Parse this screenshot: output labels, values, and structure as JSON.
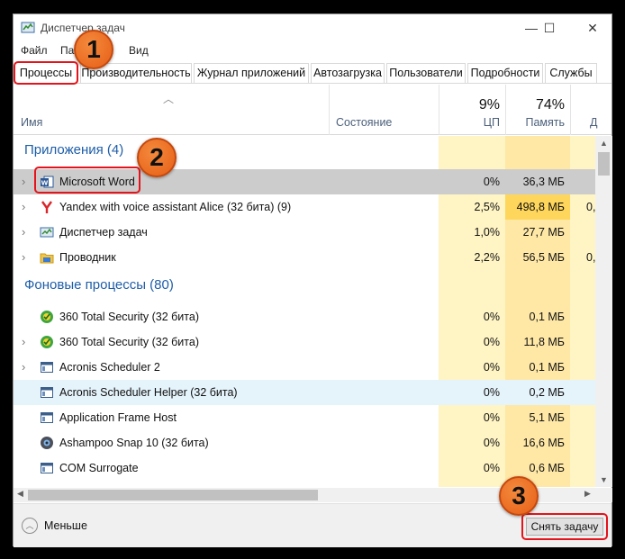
{
  "window": {
    "title": "Диспетчер задач",
    "controls": {
      "minimize": "—",
      "maximize": "☐",
      "close": "✕"
    }
  },
  "menu": {
    "items": [
      "Файл",
      "Па",
      "Вид"
    ]
  },
  "tabs": [
    "Процессы",
    "Производительность",
    "Журнал приложений",
    "Автозагрузка",
    "Пользователи",
    "Подробности",
    "Службы"
  ],
  "active_tab": 0,
  "columns": {
    "name": "Имя",
    "state": "Состояние",
    "cpu": {
      "pct": "9%",
      "label": "ЦП"
    },
    "memory": {
      "pct": "74%",
      "label": "Память"
    },
    "disk": {
      "pct": "",
      "label": "Д"
    }
  },
  "groups": {
    "apps": "Приложения (4)",
    "background": "Фоновые процессы (80)"
  },
  "apps": [
    {
      "name": "Microsoft Word",
      "cpu": "0%",
      "mem": "36,3 МБ",
      "disk": "",
      "icon": "word-icon",
      "expandable": true
    },
    {
      "name": "Yandex with voice assistant Alice (32 бита) (9)",
      "cpu": "2,5%",
      "mem": "498,8 МБ",
      "disk": "0,",
      "icon": "yandex-icon",
      "expandable": true
    },
    {
      "name": "Диспетчер задач",
      "cpu": "1,0%",
      "mem": "27,7 МБ",
      "disk": "",
      "icon": "taskmgr-icon",
      "expandable": true
    },
    {
      "name": "Проводник",
      "cpu": "2,2%",
      "mem": "56,5 МБ",
      "disk": "0,",
      "icon": "explorer-icon",
      "expandable": true
    }
  ],
  "background": [
    {
      "name": "360 Total Security (32 бита)",
      "cpu": "0%",
      "mem": "0,1 МБ",
      "icon": "360-security-icon",
      "expandable": false
    },
    {
      "name": "360 Total Security (32 бита)",
      "cpu": "0%",
      "mem": "11,8 МБ",
      "icon": "360-security-icon",
      "expandable": true
    },
    {
      "name": "Acronis Scheduler 2",
      "cpu": "0%",
      "mem": "0,1 МБ",
      "icon": "app-window-icon",
      "expandable": true
    },
    {
      "name": "Acronis Scheduler Helper (32 бита)",
      "cpu": "0%",
      "mem": "0,2 МБ",
      "icon": "app-window-icon",
      "expandable": false
    },
    {
      "name": "Application Frame Host",
      "cpu": "0%",
      "mem": "5,1 МБ",
      "icon": "app-window-icon",
      "expandable": false
    },
    {
      "name": "Ashampoo Snap 10 (32 бита)",
      "cpu": "0%",
      "mem": "16,6 МБ",
      "icon": "ashampoo-icon",
      "expandable": false
    },
    {
      "name": "COM Surrogate",
      "cpu": "0%",
      "mem": "0,6 МБ",
      "icon": "app-window-icon",
      "expandable": false
    },
    {
      "name": "",
      "cpu": "",
      "mem": "",
      "icon": "app-window-icon",
      "expandable": false
    }
  ],
  "footer": {
    "less_label": "Меньше",
    "end_task_label": "Снять задачу"
  },
  "callouts": [
    "1",
    "2",
    "3"
  ],
  "colors": {
    "highlight_red": "#e3141b",
    "callout_orange": "#ee7023",
    "group_blue": "#1e5ea8",
    "cpu_heat_light": "#fff4c4",
    "mem_heat": "#ffe8a6",
    "mem_heat_strong": "#ffd65c"
  }
}
